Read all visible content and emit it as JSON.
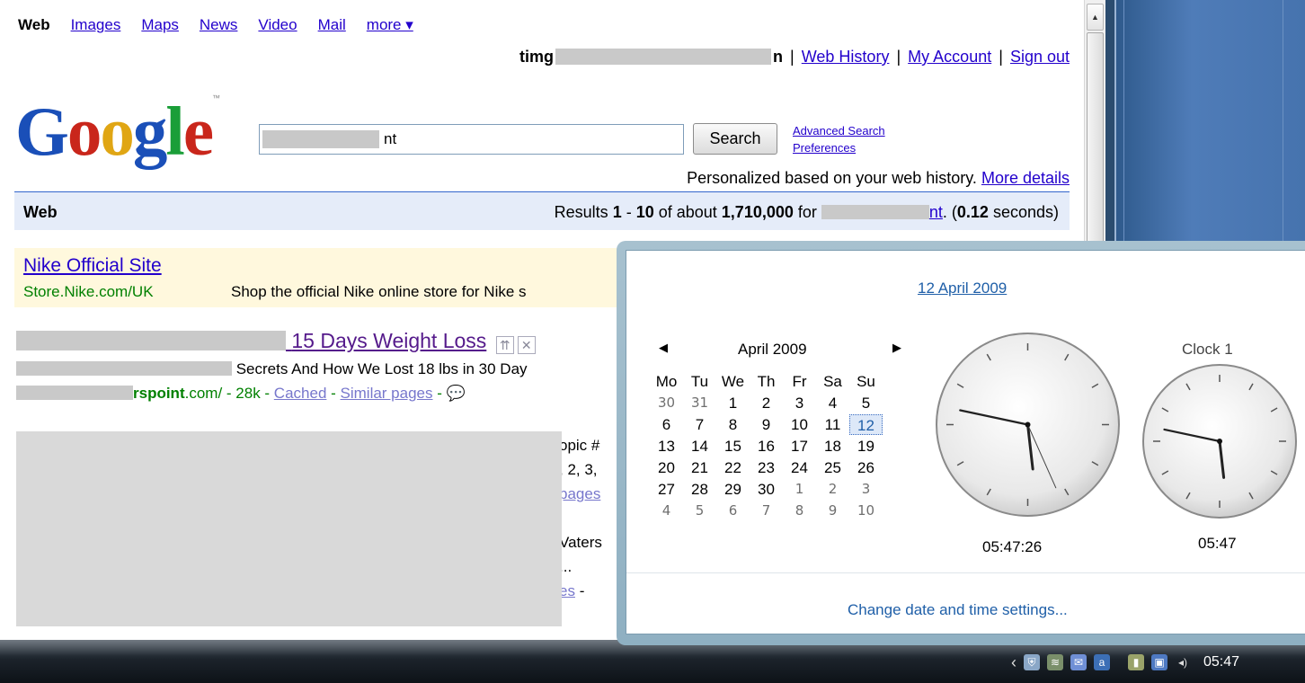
{
  "topnav": {
    "web": "Web",
    "images": "Images",
    "maps": "Maps",
    "news": "News",
    "video": "Video",
    "mail": "Mail",
    "more": "more ▾"
  },
  "userbar": {
    "user_prefix": "timg",
    "user_suffix": "n",
    "web_history": "Web History",
    "my_account": "My Account",
    "sign_out": "Sign out",
    "separator": "|"
  },
  "logo": {
    "letters": [
      "G",
      "o",
      "o",
      "g",
      "l",
      "e"
    ],
    "trademark": "™"
  },
  "search": {
    "value_suffix": "nt",
    "button": "Search",
    "advanced": "Advanced Search",
    "preferences": "Preferences"
  },
  "personalized": {
    "text": "Personalized based on your web history.",
    "link": "More details"
  },
  "results_bar": {
    "label": "Web",
    "prefix": "Results ",
    "start": "1",
    "dash": " - ",
    "end": "10",
    "of_about": " of about ",
    "total": "1,710,000",
    "for": " for ",
    "query_suffix": "nt",
    "time_open": ". (",
    "time": "0.12",
    "time_close": " seconds)"
  },
  "ad": {
    "title": "Nike Official Site",
    "url": "Store.Nike.com/UK",
    "desc": "Shop the official Nike online store for Nike s"
  },
  "result1": {
    "title": "15 Days Weight Loss",
    "snippet": " Secrets And How We Lost 18 lbs in 30 Day",
    "url_bold": "rspoint",
    "url_rest": ".com/ - 28k - ",
    "cached": "Cached",
    "dash": " - ",
    "similar": "Similar pages",
    "dash2": " - "
  },
  "result2_fragments": {
    "line1": "opic #",
    "line2": ", 2, 3,",
    "line3": "pages",
    "line4": "Vaters",
    "line5": "...",
    "line6": "es",
    "line6_dash": " -"
  },
  "flyout": {
    "date": "12 April 2009",
    "month": "April 2009",
    "prev": "◀",
    "next": "▶",
    "weekdays": [
      "Mo",
      "Tu",
      "We",
      "Th",
      "Fr",
      "Sa",
      "Su"
    ],
    "days": [
      {
        "d": "30",
        "other": true
      },
      {
        "d": "31",
        "other": true
      },
      {
        "d": "1"
      },
      {
        "d": "2"
      },
      {
        "d": "3"
      },
      {
        "d": "4"
      },
      {
        "d": "5"
      },
      {
        "d": "6"
      },
      {
        "d": "7"
      },
      {
        "d": "8"
      },
      {
        "d": "9"
      },
      {
        "d": "10"
      },
      {
        "d": "11"
      },
      {
        "d": "12",
        "today": true
      },
      {
        "d": "13"
      },
      {
        "d": "14"
      },
      {
        "d": "15"
      },
      {
        "d": "16"
      },
      {
        "d": "17"
      },
      {
        "d": "18"
      },
      {
        "d": "19"
      },
      {
        "d": "20"
      },
      {
        "d": "21"
      },
      {
        "d": "22"
      },
      {
        "d": "23"
      },
      {
        "d": "24"
      },
      {
        "d": "25"
      },
      {
        "d": "26"
      },
      {
        "d": "27"
      },
      {
        "d": "28"
      },
      {
        "d": "29"
      },
      {
        "d": "30"
      },
      {
        "d": "1",
        "other": true
      },
      {
        "d": "2",
        "other": true
      },
      {
        "d": "3",
        "other": true
      },
      {
        "d": "4",
        "other": true
      },
      {
        "d": "5",
        "other": true
      },
      {
        "d": "6",
        "other": true
      },
      {
        "d": "7",
        "other": true
      },
      {
        "d": "8",
        "other": true
      },
      {
        "d": "9",
        "other": true
      },
      {
        "d": "10",
        "other": true
      }
    ],
    "clock1": {
      "time": "05:47:26",
      "hours": 5,
      "minutes": 47,
      "seconds": 26
    },
    "clock2": {
      "title": "Clock 1",
      "time": "05:47",
      "hours": 5,
      "minutes": 47
    },
    "change_settings": "Change date and time settings..."
  },
  "taskbar": {
    "clock": "05:47",
    "icons": [
      "show-hidden-icon",
      "security-icon",
      "network-icon",
      "mail-icon",
      "antivirus-icon",
      "power-icon",
      "network-status-icon",
      "volume-icon"
    ]
  },
  "colors": {
    "link": "#2200cc",
    "green_url": "#008000",
    "results_bar_bg": "#e5ecf9",
    "ad_bg": "#fff8dd",
    "flyout_accent": "#1f5fa8"
  }
}
